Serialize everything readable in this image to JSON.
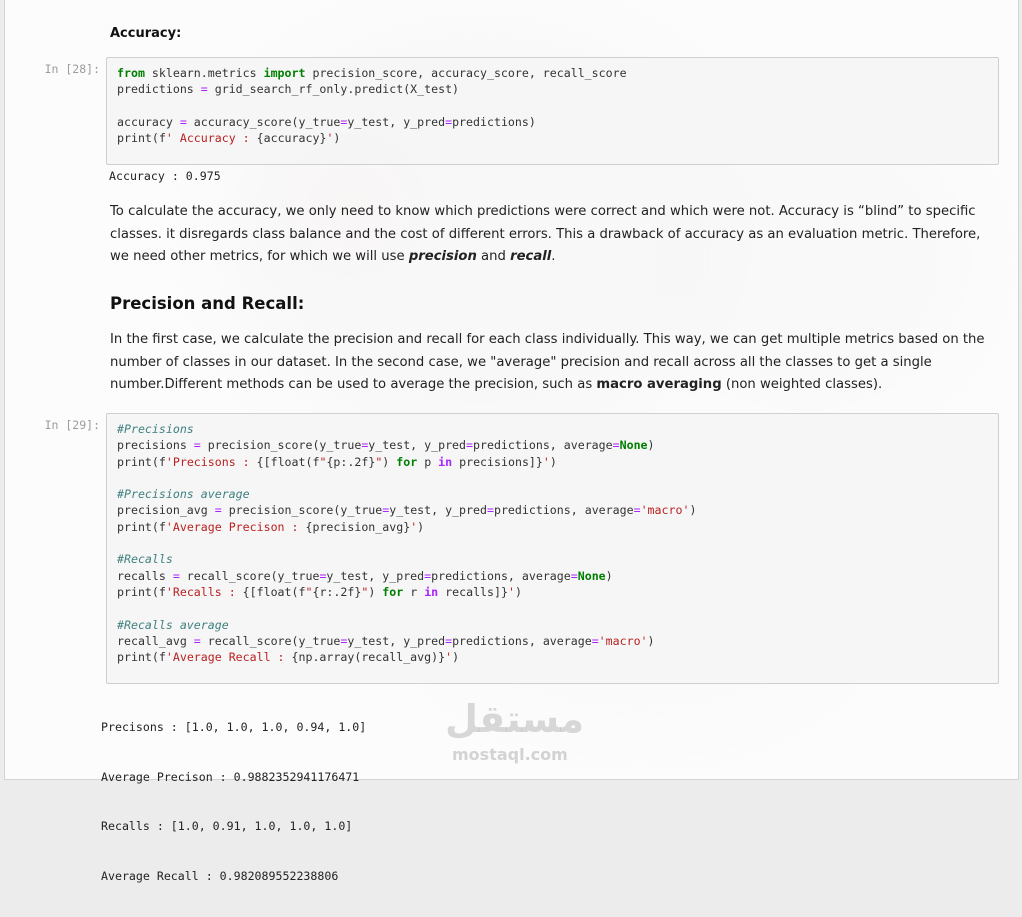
{
  "cells": {
    "accuracy_heading": "Accuracy:",
    "cell28": {
      "prompt": "In [28]:",
      "lines": [
        [
          [
            "kw",
            "from"
          ],
          [
            "t",
            " sklearn.metrics "
          ],
          [
            "kw",
            "import"
          ],
          [
            "t",
            " precision_score, accuracy_score, recall_score"
          ]
        ],
        [
          [
            "t",
            "predictions "
          ],
          [
            "op",
            "="
          ],
          [
            "t",
            " grid_search_rf_only.predict(X_test)"
          ]
        ],
        [],
        [
          [
            "t",
            "accuracy "
          ],
          [
            "op",
            "="
          ],
          [
            "t",
            " accuracy_score(y_true"
          ],
          [
            "op",
            "="
          ],
          [
            "t",
            "y_test, y_pred"
          ],
          [
            "op",
            "="
          ],
          [
            "t",
            "predictions)"
          ]
        ],
        [
          [
            "t",
            "print(f"
          ],
          [
            "str",
            "' Accuracy : "
          ],
          [
            "t",
            "{accuracy}"
          ],
          [
            "str",
            "'"
          ],
          [
            "t",
            ")"
          ]
        ]
      ],
      "output": "Accuracy : 0.975"
    },
    "para1": [
      [
        "t",
        "To calculate the accuracy, we only need to know which predictions were correct and which were not. Accuracy is “blind” to specific classes. it disregards class balance and the cost of different errors. This a drawback of accuracy as an evaluation metric. Therefore, we need other metrics, for which we will use "
      ],
      [
        "bi",
        "precision"
      ],
      [
        "t",
        " and "
      ],
      [
        "bi",
        "recall"
      ],
      [
        "t",
        "."
      ]
    ],
    "pr_heading": "Precision and Recall:",
    "para2": [
      [
        "t",
        "In the first case, we calculate the precision and recall for each class individually. This way, we can get multiple metrics based on the number of classes in our dataset. In the second case, we \"average\" precision and recall across all the classes to get a single number.Different methods can be used to average the precision, such as "
      ],
      [
        "b",
        "macro averaging"
      ],
      [
        "t",
        " (non weighted classes)."
      ]
    ],
    "cell29": {
      "prompt": "In [29]:",
      "lines": [
        [
          [
            "cm",
            "#Precisions"
          ]
        ],
        [
          [
            "t",
            "precisions "
          ],
          [
            "op",
            "="
          ],
          [
            "t",
            " precision_score(y_true"
          ],
          [
            "op",
            "="
          ],
          [
            "t",
            "y_test, y_pred"
          ],
          [
            "op",
            "="
          ],
          [
            "t",
            "predictions, average"
          ],
          [
            "op",
            "="
          ],
          [
            "kw",
            "None"
          ],
          [
            "t",
            ")"
          ]
        ],
        [
          [
            "t",
            "print(f"
          ],
          [
            "str",
            "'Precisons : "
          ],
          [
            "t",
            "{[float(f"
          ],
          [
            "str",
            "\""
          ],
          [
            "t",
            "{p:.2f}"
          ],
          [
            "str",
            "\""
          ],
          [
            "t",
            ") "
          ],
          [
            "kw",
            "for"
          ],
          [
            "t",
            " p "
          ],
          [
            "kw2",
            "in"
          ],
          [
            "t",
            " precisions]}"
          ],
          [
            "str",
            "'"
          ],
          [
            "t",
            ")"
          ]
        ],
        [],
        [
          [
            "cm",
            "#Precisions average"
          ]
        ],
        [
          [
            "t",
            "precision_avg "
          ],
          [
            "op",
            "="
          ],
          [
            "t",
            " precision_score(y_true"
          ],
          [
            "op",
            "="
          ],
          [
            "t",
            "y_test, y_pred"
          ],
          [
            "op",
            "="
          ],
          [
            "t",
            "predictions, average"
          ],
          [
            "op",
            "="
          ],
          [
            "str",
            "'macro'"
          ],
          [
            "t",
            ")"
          ]
        ],
        [
          [
            "t",
            "print(f"
          ],
          [
            "str",
            "'Average Precison : "
          ],
          [
            "t",
            "{precision_avg}"
          ],
          [
            "str",
            "'"
          ],
          [
            "t",
            ")"
          ]
        ],
        [],
        [
          [
            "cm",
            "#Recalls"
          ]
        ],
        [
          [
            "t",
            "recalls "
          ],
          [
            "op",
            "="
          ],
          [
            "t",
            " recall_score(y_true"
          ],
          [
            "op",
            "="
          ],
          [
            "t",
            "y_test, y_pred"
          ],
          [
            "op",
            "="
          ],
          [
            "t",
            "predictions, average"
          ],
          [
            "op",
            "="
          ],
          [
            "kw",
            "None"
          ],
          [
            "t",
            ")"
          ]
        ],
        [
          [
            "t",
            "print(f"
          ],
          [
            "str",
            "'Recalls : "
          ],
          [
            "t",
            "{[float(f"
          ],
          [
            "str",
            "\""
          ],
          [
            "t",
            "{r:.2f}"
          ],
          [
            "str",
            "\""
          ],
          [
            "t",
            ") "
          ],
          [
            "kw",
            "for"
          ],
          [
            "t",
            " r "
          ],
          [
            "kw2",
            "in"
          ],
          [
            "t",
            " recalls]}"
          ],
          [
            "str",
            "'"
          ],
          [
            "t",
            ")"
          ]
        ],
        [],
        [
          [
            "cm",
            "#Recalls average"
          ]
        ],
        [
          [
            "t",
            "recall_avg "
          ],
          [
            "op",
            "="
          ],
          [
            "t",
            " recall_score(y_true"
          ],
          [
            "op",
            "="
          ],
          [
            "t",
            "y_test, y_pred"
          ],
          [
            "op",
            "="
          ],
          [
            "t",
            "predictions, average"
          ],
          [
            "op",
            "="
          ],
          [
            "str",
            "'macro'"
          ],
          [
            "t",
            ")"
          ]
        ],
        [
          [
            "t",
            "print(f"
          ],
          [
            "str",
            "'Average Recall : "
          ],
          [
            "t",
            "{np.array(recall_avg)}"
          ],
          [
            "str",
            "'"
          ],
          [
            "t",
            ")"
          ]
        ]
      ],
      "output": [
        "Precisons : [1.0, 1.0, 1.0, 0.94, 1.0]",
        "Average Precison : 0.9882352941176471",
        "Recalls : [1.0, 0.91, 1.0, 1.0, 1.0]",
        "Average Recall : 0.982089552238806"
      ]
    }
  },
  "watermark": {
    "logo_text": "مستقل",
    "site_text": "mostaql.com"
  }
}
